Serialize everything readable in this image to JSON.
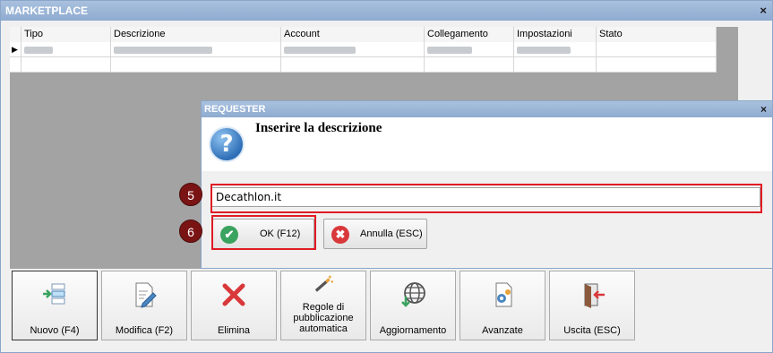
{
  "window": {
    "title": "MARKETPLACE",
    "close": "×"
  },
  "grid": {
    "columns": [
      "Tipo",
      "Descrizione",
      "Account",
      "Collegamento",
      "Impostazioni",
      "Stato"
    ],
    "row_pointer": "▶"
  },
  "dialog": {
    "title": "REQUESTER",
    "close": "×",
    "icon_glyph": "?",
    "prompt": "Inserire la descrizione",
    "input_value": "Decathlon.it",
    "ok_label": "OK (F12)",
    "ok_glyph": "✔",
    "cancel_label": "Annulla (ESC)",
    "cancel_glyph": "✖"
  },
  "annotations": {
    "step_input": "5",
    "step_ok": "6"
  },
  "toolbar": [
    {
      "label": "Nuovo (F4)",
      "icon": "new-record-icon"
    },
    {
      "label": "Modifica (F2)",
      "icon": "edit-icon"
    },
    {
      "label": "Elimina",
      "icon": "delete-icon"
    },
    {
      "label": "Regole di pubblicazione automatica",
      "icon": "magic-wand-icon"
    },
    {
      "label": "Aggiornamento",
      "icon": "globe-download-icon"
    },
    {
      "label": "Avanzate",
      "icon": "settings-document-icon"
    },
    {
      "label": "Uscita (ESC)",
      "icon": "exit-door-icon"
    }
  ],
  "colors": {
    "accent_red": "#e01b24",
    "ok_green": "#3aa35f",
    "cancel_red": "#d9383a",
    "titlebar": "#8eabd0"
  }
}
